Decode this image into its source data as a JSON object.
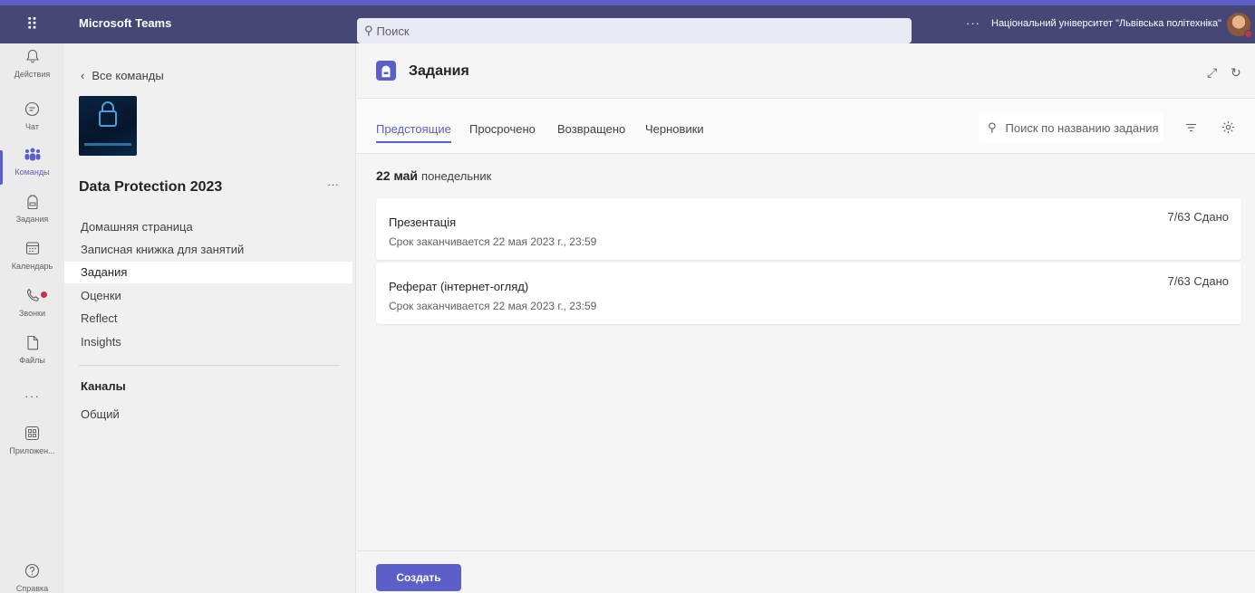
{
  "topbar": {
    "app_name": "Microsoft Teams",
    "search_placeholder": "Поиск",
    "more": "···",
    "org_name": "Національний університет \"Львівська політехніка\""
  },
  "rail": [
    {
      "label": "Действия",
      "icon": "bell-icon"
    },
    {
      "label": "Чат",
      "icon": "chat-icon"
    },
    {
      "label": "Команды",
      "icon": "teams-icon",
      "active": true
    },
    {
      "label": "Задания",
      "icon": "assignments-icon"
    },
    {
      "label": "Календарь",
      "icon": "calendar-icon"
    },
    {
      "label": "Звонки",
      "icon": "phone-icon",
      "badge": true
    },
    {
      "label": "Файлы",
      "icon": "file-icon"
    },
    {
      "label": "···",
      "icon": "more-icon"
    },
    {
      "label": "Приложен...",
      "icon": "apps-icon"
    },
    {
      "label": "Справка",
      "icon": "help-icon"
    }
  ],
  "team": {
    "back_label": "Все команды",
    "name": "Data Protection 2023",
    "more": "···",
    "nav": [
      {
        "label": "Домашняя страница"
      },
      {
        "label": "Записная книжка для занятий"
      },
      {
        "label": "Задания",
        "selected": true
      },
      {
        "label": "Оценки"
      },
      {
        "label": "Reflect"
      },
      {
        "label": "Insights"
      }
    ],
    "channels_heading": "Каналы",
    "channels": [
      {
        "label": "Общий"
      }
    ]
  },
  "main": {
    "title": "Задания",
    "tabs": [
      {
        "label": "Предстоящие",
        "active": true
      },
      {
        "label": "Просрочено"
      },
      {
        "label": "Возвращено"
      },
      {
        "label": "Черновики"
      }
    ],
    "search_placeholder": "Поиск по названию задания",
    "date": {
      "day": "22 май",
      "weekday": "понедельник"
    },
    "assignments": [
      {
        "title": "Презентація",
        "due": "Срок заканчивается 22 мая 2023 г., 23:59",
        "status": "7/63 Сдано"
      },
      {
        "title": "Реферат (інтернет-огляд)",
        "due": "Срок заканчивается 22 мая 2023 г., 23:59",
        "status": "7/63 Сдано"
      }
    ],
    "create_label": "Создать"
  },
  "colors": {
    "brand": "#5b5fc7",
    "topbar": "#464775",
    "badge": "#c4314b"
  }
}
